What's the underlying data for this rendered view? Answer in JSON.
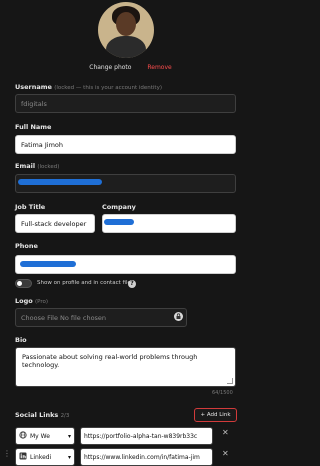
{
  "photo": {
    "change_label": "Change photo",
    "remove_label": "Remove"
  },
  "username": {
    "label": "Username",
    "hint": "(locked — this is your account identity)",
    "value": "fdigitals"
  },
  "full_name": {
    "label": "Full Name",
    "value": "Fatima Jimoh"
  },
  "email": {
    "label": "Email",
    "hint": "(locked)"
  },
  "job_title": {
    "label": "Job Title",
    "value": "Full-stack developer"
  },
  "company": {
    "label": "Company"
  },
  "phone": {
    "label": "Phone"
  },
  "toggle": {
    "label": "Show on profile and in contact file",
    "help": "?"
  },
  "logo": {
    "label": "Logo",
    "hint": "(Pro)",
    "file_label": "Choose File No file chosen"
  },
  "bio": {
    "label": "Bio",
    "value": "Passionate about solving real-world problems through technology.",
    "counter": "64/1500"
  },
  "social": {
    "label": "Social Links",
    "count": "2/3",
    "add_label": "+ Add Link",
    "links": [
      {
        "type": "My We",
        "url": "https://portfolio-alpha-tan-w839rb33c",
        "icon": "globe-icon"
      },
      {
        "type": "Linkedi",
        "url": "https://www.linkedin.com/in/fatima-jim",
        "icon": "linkedin-icon"
      }
    ]
  }
}
